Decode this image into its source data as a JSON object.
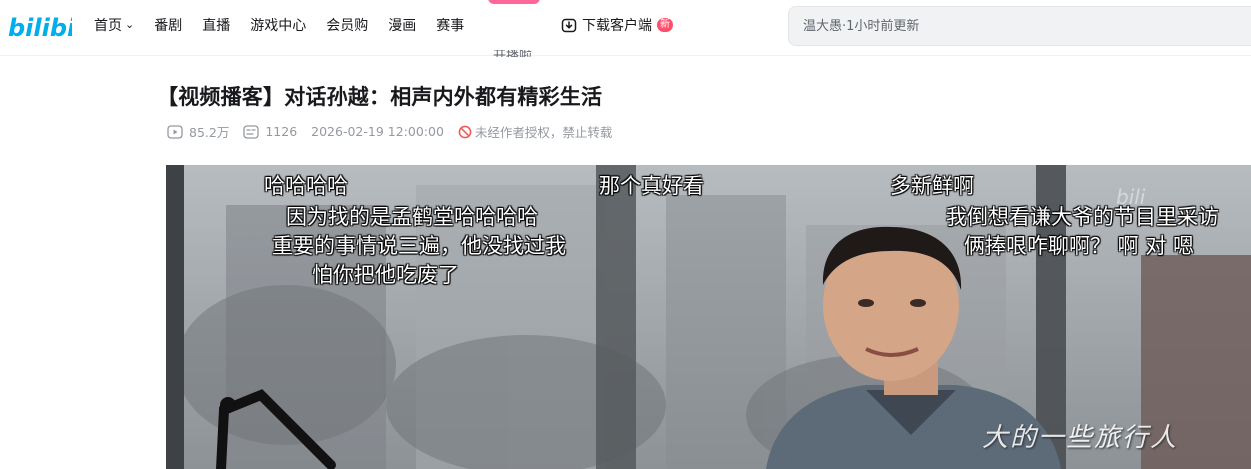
{
  "header": {
    "logo_text": "bilibili",
    "nav": [
      {
        "label": "首页",
        "has_dropdown": true
      },
      {
        "label": "番剧"
      },
      {
        "label": "直播"
      },
      {
        "label": "游戏中心"
      },
      {
        "label": "会员购"
      },
      {
        "label": "漫画"
      },
      {
        "label": "赛事"
      }
    ],
    "kaibo_cut": "开播啦",
    "download_label": "下载客户端",
    "download_badge": "新",
    "search_placeholder": "温大愚·1小时前更新"
  },
  "video": {
    "title": "【视频播客】对话孙越：相声内外都有精彩生活",
    "views": "85.2万",
    "danmaku_count": "1126",
    "datetime": "2026-02-19 12:00:00",
    "copyright_notice": "未经作者授权，禁止转载",
    "danmaku": [
      "哈哈哈哈",
      "因为找的是孟鹤堂哈哈哈哈",
      "重要的事情说三遍，他没找过我",
      "怕你把他吃废了",
      "那个真好看",
      "多新鲜啊",
      "我倒想看谦大爷的节目里采访",
      "俩捧哏咋聊啊？ 啊 对 嗯"
    ],
    "watermark_signature": "大的一些旅行人"
  },
  "colors": {
    "brand": "#00aeec",
    "pink": "#ff6699",
    "badge": "#ff4d6a",
    "meta_text": "#9499a0",
    "warn": "#f25d59"
  },
  "icons": {
    "logo": "bilibili-logo",
    "chevron": "chevron-down-icon",
    "download": "download-icon",
    "play": "play-count-icon",
    "danmaku": "danmaku-icon",
    "warn": "no-reprint-icon"
  }
}
